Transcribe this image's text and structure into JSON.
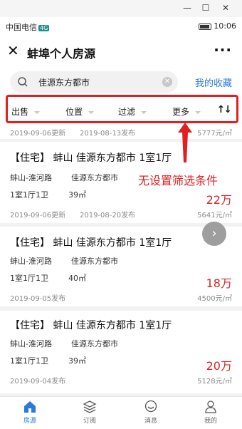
{
  "window": {
    "minimize": "—",
    "maximize": "☐",
    "close": "✕"
  },
  "statusbar": {
    "carrier": "中国电信",
    "net": "4G",
    "time": "10:06",
    "battery_icon": "battery-icon"
  },
  "appbar": {
    "title": "蚌埠个人房源",
    "close_icon": "close-icon",
    "more_icon": "more-icon"
  },
  "search": {
    "value": "佳源东方都市",
    "favorites": "我的收藏"
  },
  "filters": [
    {
      "label": "出售"
    },
    {
      "label": "位置"
    },
    {
      "label": "过滤"
    },
    {
      "label": "更多"
    }
  ],
  "sort_icon": "sort-icon",
  "annotation": {
    "text": "无设置筛选条件",
    "color": "#e02020"
  },
  "partial_listing": {
    "date": "2019-09-06更新",
    "published": "2019-08-13发布",
    "unit_price": "5777元/㎡"
  },
  "listings": [
    {
      "title": "【住宅】 蚌山 佳源东方都市 1室1厅",
      "district": "蚌山-淮河路",
      "community": "佳源东方都市",
      "layout": "1室1厅1卫",
      "area": "39㎡",
      "price": "22万",
      "date": "2019-09-06更新",
      "published": "2019-08-20发布",
      "unit_price": "5641元/㎡"
    },
    {
      "title": "【住宅】 蚌山 佳源东方都市 1室1厅",
      "district": "蚌山-淮河路",
      "community": "佳源东方都市",
      "layout": "1室1厅1卫",
      "area": "40㎡",
      "price": "18万",
      "date": "2019-09-05发布",
      "published": "",
      "unit_price": "4500元/㎡"
    },
    {
      "title": "【住宅】 蚌山 佳源东方都市 1室1厅",
      "district": "蚌山-淮河路",
      "community": "佳源东方都市",
      "layout": "1室1厅1卫",
      "area": "39㎡",
      "price": "20万",
      "date": "2019-09-04发布",
      "published": "",
      "unit_price": "5128元/㎡"
    }
  ],
  "tabs": [
    {
      "label": "房源",
      "icon": "house-icon"
    },
    {
      "label": "订阅",
      "icon": "layers-icon"
    },
    {
      "label": "消息",
      "icon": "chat-icon"
    },
    {
      "label": "我的",
      "icon": "user-icon"
    }
  ],
  "colors": {
    "accent": "#2a7ad9",
    "price": "#d12727"
  }
}
